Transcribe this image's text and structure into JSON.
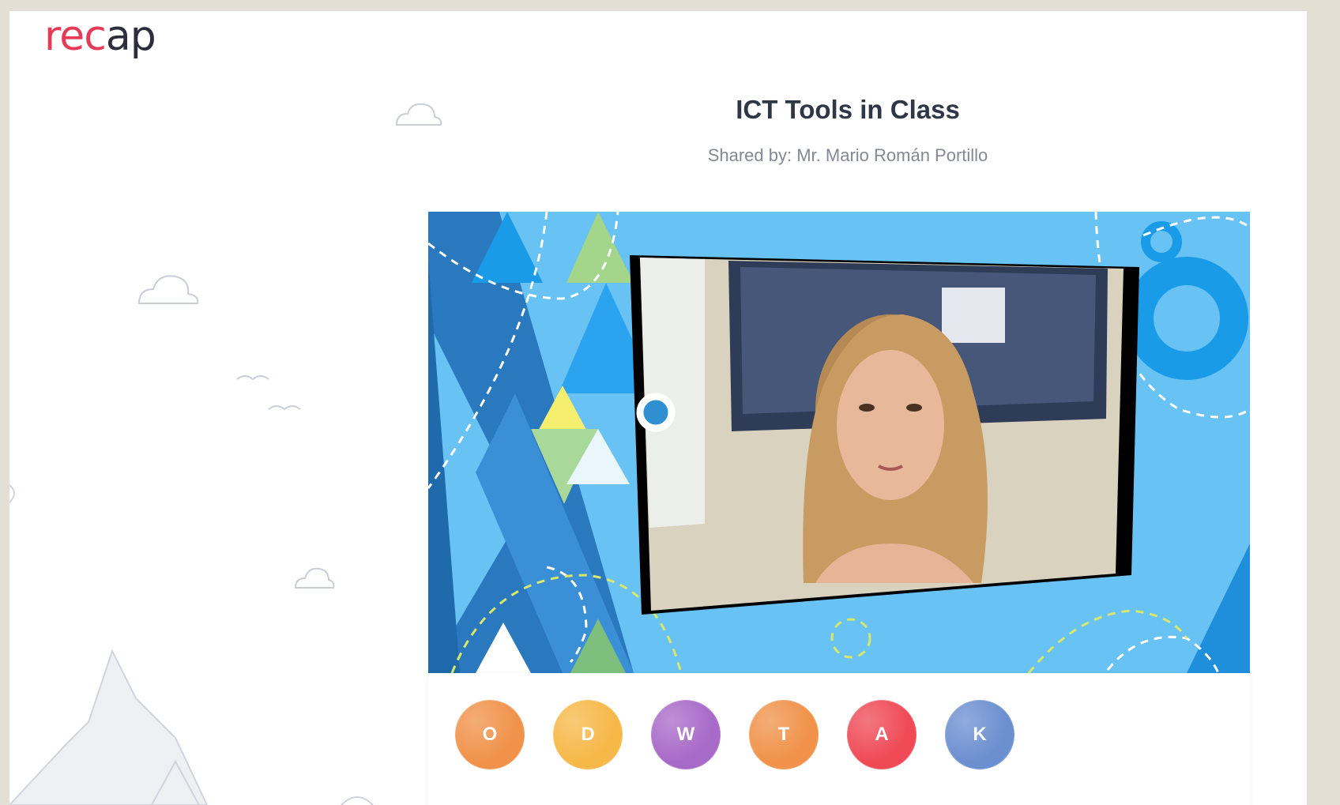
{
  "brand": {
    "logo_re": "rec",
    "logo_cap": "ap"
  },
  "page": {
    "title": "ICT Tools in Class",
    "shared_by": "Shared by: Mr. Mario Román Portillo"
  },
  "participants": [
    {
      "initial": "O",
      "color": "#f0924a"
    },
    {
      "initial": "D",
      "color": "#f6b848"
    },
    {
      "initial": "W",
      "color": "#a86ac8"
    },
    {
      "initial": "T",
      "color": "#f0924a"
    },
    {
      "initial": "A",
      "color": "#ef4a56"
    },
    {
      "initial": "K",
      "color": "#6c8fd0"
    }
  ],
  "colors": {
    "brand_red": "#e63a56",
    "video_bg": "#68c2f4",
    "dark_blue": "#2a78bd"
  }
}
